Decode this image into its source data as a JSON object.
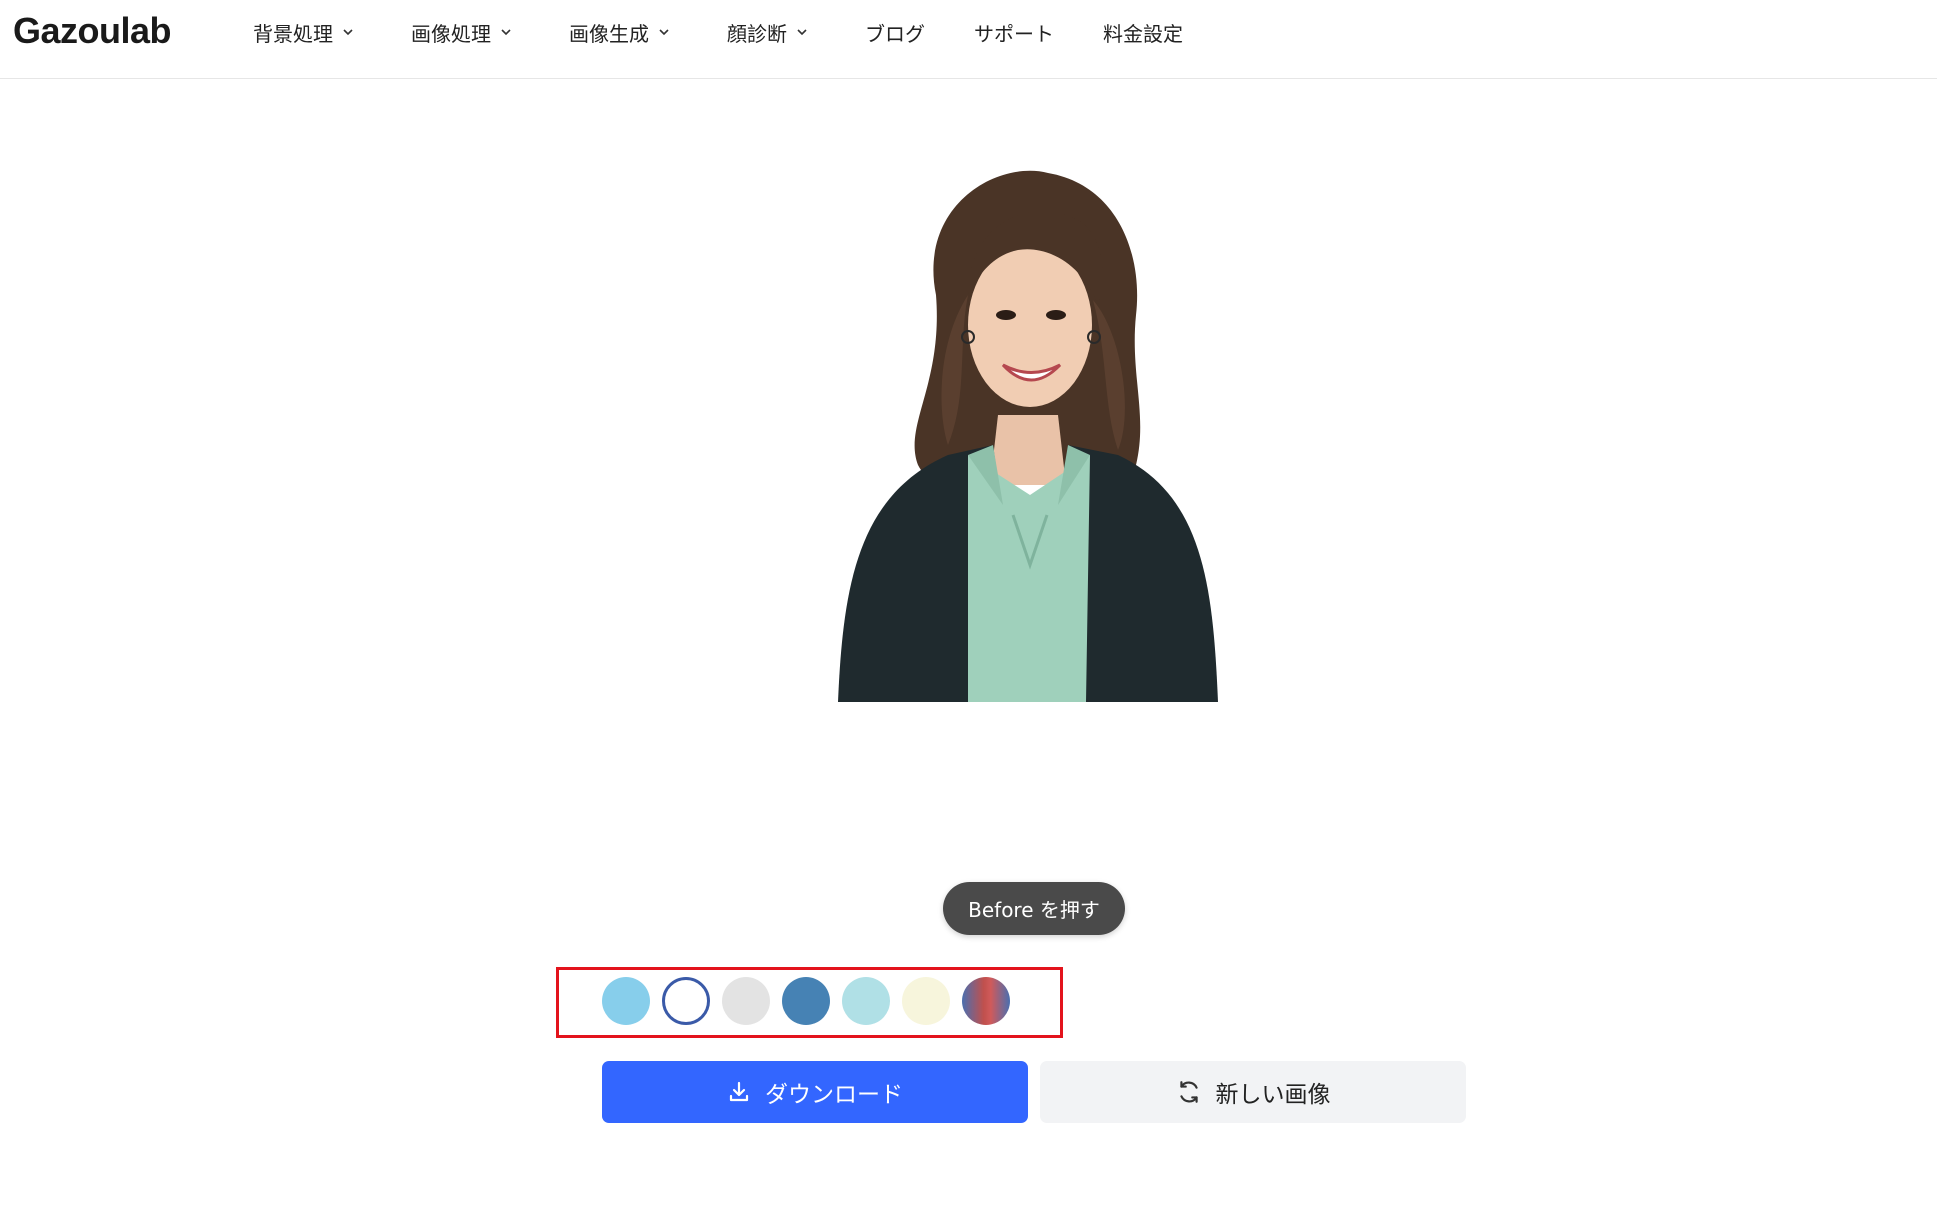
{
  "header": {
    "logo": "Gazoulab",
    "nav": [
      {
        "label": "背景処理",
        "has_dropdown": true
      },
      {
        "label": "画像処理",
        "has_dropdown": true
      },
      {
        "label": "画像生成",
        "has_dropdown": true
      },
      {
        "label": "顔診断",
        "has_dropdown": true
      },
      {
        "label": "ブログ",
        "has_dropdown": false
      },
      {
        "label": "サポート",
        "has_dropdown": false
      },
      {
        "label": "料金設定",
        "has_dropdown": false
      }
    ]
  },
  "tooltip": {
    "text": "Before を押す"
  },
  "swatches": [
    {
      "color": "#87ceeb",
      "selected": false
    },
    {
      "color": "#ffffff",
      "selected": true
    },
    {
      "color": "#e3e3e3",
      "selected": false
    },
    {
      "color": "#4682b4",
      "selected": false
    },
    {
      "color": "#b0e0e6",
      "selected": false
    },
    {
      "color": "#f7f5dc",
      "selected": false
    },
    {
      "color": "gradient-red-blue",
      "selected": false
    }
  ],
  "actions": {
    "download_label": "ダウンロード",
    "download_icon": "download-icon",
    "new_image_label": "新しい画像",
    "new_image_icon": "refresh-icon"
  },
  "colors": {
    "primary": "#3366ff",
    "highlight_frame": "#e3131c",
    "tooltip_bg": "#4a4a4a"
  }
}
